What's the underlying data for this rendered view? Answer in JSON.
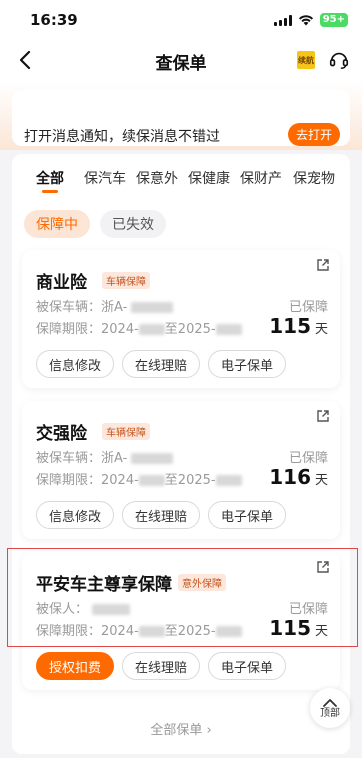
{
  "status_bar": {
    "time": "16:39",
    "battery": "95+"
  },
  "nav": {
    "title": "查保单",
    "icon1_text": "续航"
  },
  "notice": {
    "text": "打开消息通知，续保消息不错过",
    "button": "去打开"
  },
  "tabs": [
    "全部",
    "保汽车",
    "保意外",
    "保健康",
    "保财产",
    "保宠物"
  ],
  "filters": {
    "active": "保障中",
    "inactive": "已失效"
  },
  "policies": [
    {
      "name": "商业险",
      "tag": "车辆保障",
      "line1_label": "被保车辆：",
      "line1_value": "浙A-",
      "line2_label": "保障期限：",
      "line2_value_a": "2024-",
      "line2_mid": "至2025-",
      "status": "已保障",
      "days": "115",
      "days_unit": "天",
      "actions": [
        "信息修改",
        "在线理赔",
        "电子保单"
      ]
    },
    {
      "name": "交强险",
      "tag": "车辆保障",
      "line1_label": "被保车辆：",
      "line1_value": "浙A-",
      "line2_label": "保障期限：",
      "line2_value_a": "2024-",
      "line2_mid": "至2025-",
      "status": "已保障",
      "days": "116",
      "days_unit": "天",
      "actions": [
        "信息修改",
        "在线理赔",
        "电子保单"
      ]
    },
    {
      "name": "平安车主尊享保障",
      "tag": "意外保障",
      "line1_label": "被保人：",
      "line1_value": "",
      "line2_label": "保障期限：",
      "line2_value_a": "2024-",
      "line2_mid": "至2025-",
      "status": "已保障",
      "days": "115",
      "days_unit": "天",
      "actions": [
        "授权扣费",
        "在线理赔",
        "电子保单"
      ]
    }
  ],
  "footer": {
    "view_all": "全部保单 ›",
    "top_label": "顶部"
  },
  "colors": {
    "accent": "#ff6a00",
    "highlight": "#e04848"
  }
}
